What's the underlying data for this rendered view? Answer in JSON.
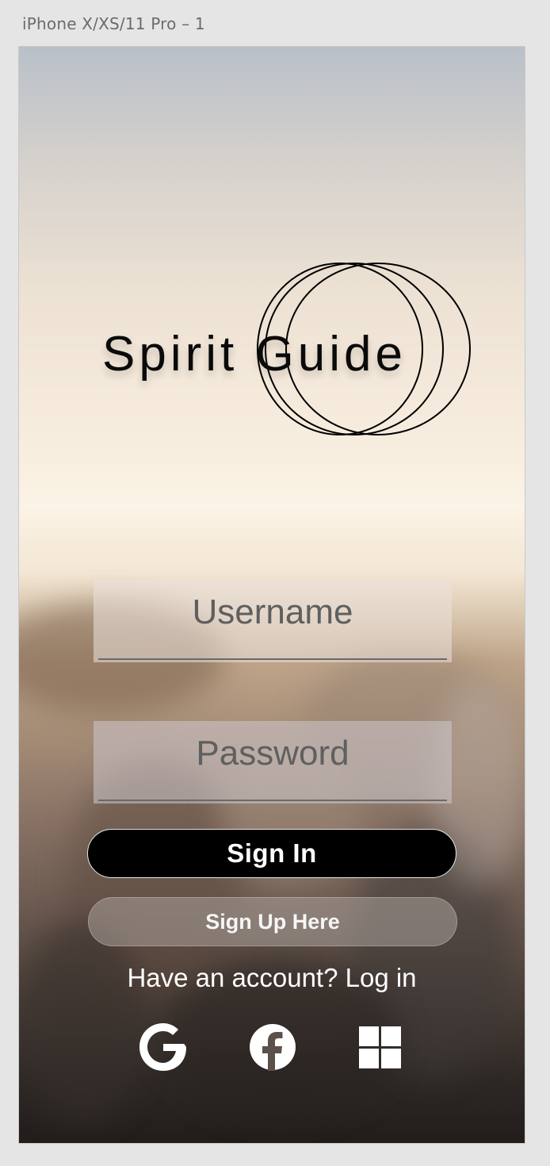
{
  "artboard": {
    "label": "iPhone X/XS/11 Pro – 1"
  },
  "brand": {
    "title": "Spirit Guide"
  },
  "form": {
    "username_placeholder": "Username",
    "password_placeholder": "Password",
    "signin_label": "Sign In",
    "signup_label": "Sign Up Here",
    "have_account_text": "Have an account? Log in"
  },
  "social": [
    {
      "name": "google",
      "icon": "google-icon"
    },
    {
      "name": "facebook",
      "icon": "facebook-icon"
    },
    {
      "name": "windows",
      "icon": "windows-icon"
    }
  ],
  "colors": {
    "signin_bg": "#000000",
    "text_light": "#ffffff"
  }
}
